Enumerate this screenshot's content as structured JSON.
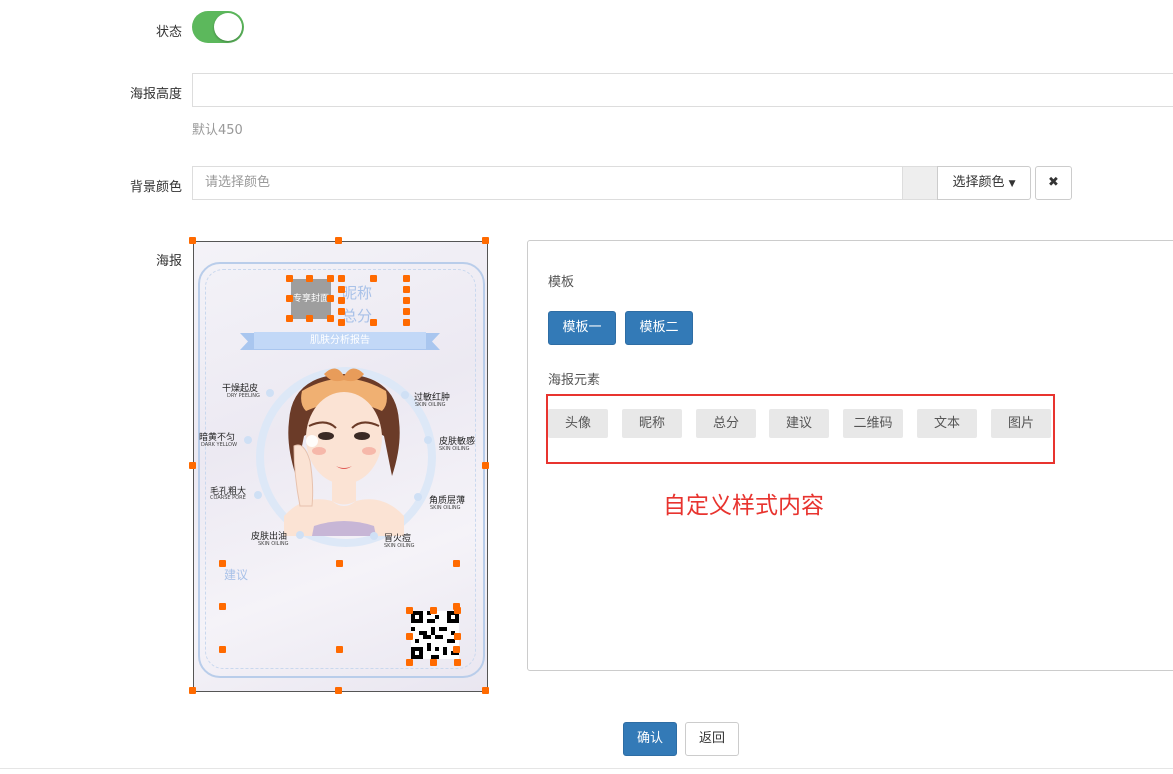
{
  "form": {
    "status_label": "状态",
    "height_label": "海报高度",
    "height_value": "",
    "height_help": "默认450",
    "bg_label": "背景颜色",
    "bg_placeholder": "请选择颜色",
    "bg_select_label": "选择颜色",
    "poster_label": "海报"
  },
  "panel": {
    "template_title": "模板",
    "templates": [
      "模板一",
      "模板二"
    ],
    "elements_title": "海报元素",
    "elements": [
      "头像",
      "昵称",
      "总分",
      "建议",
      "二维码",
      "文本",
      "图片"
    ],
    "annotation": "自定义样式内容"
  },
  "poster": {
    "avatar_text": "专享封面",
    "nickname": "昵称",
    "score": "总分",
    "banner": "肌肤分析报告",
    "suggest": "建议",
    "features": [
      {
        "label": "干燥起皮",
        "sub": "DRY PEELING"
      },
      {
        "label": "过敏红肿",
        "sub": "SKIN OILING"
      },
      {
        "label": "暗黄不匀",
        "sub": "DARK YELLOW"
      },
      {
        "label": "皮肤敏感",
        "sub": "SKIN OILING"
      },
      {
        "label": "毛孔粗大",
        "sub": "COARSE PORE"
      },
      {
        "label": "角质层薄",
        "sub": "SKIN OILING"
      },
      {
        "label": "皮肤出油",
        "sub": "SKIN OILING"
      },
      {
        "label": "冒火痘",
        "sub": "SKIN OILING"
      }
    ]
  },
  "footer": {
    "confirm": "确认",
    "back": "返回"
  },
  "colors": {
    "primary": "#337ab7",
    "toggle_on": "#5cb85c",
    "handle": "#ff6a00",
    "annotation": "#e8342f"
  }
}
